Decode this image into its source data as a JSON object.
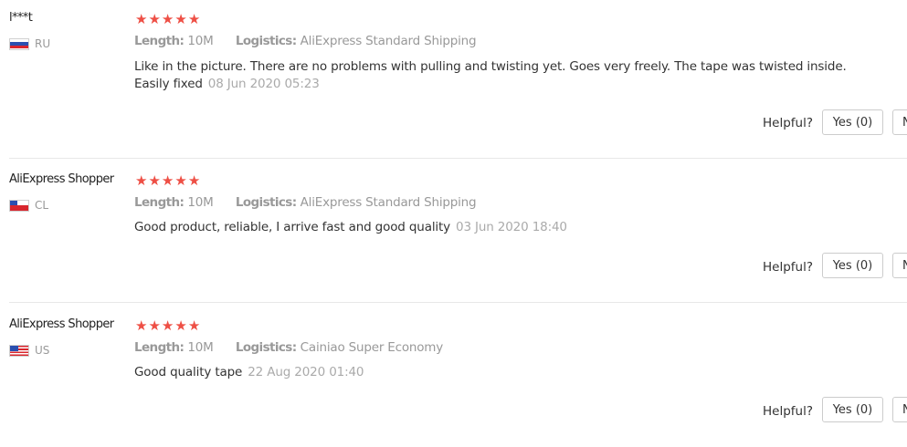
{
  "reviews": [
    {
      "user": "l***t",
      "country_code": "RU",
      "flag": "russia-flag",
      "stars": 5,
      "length_label": "Length:",
      "length_value": "10M",
      "logistics_label": "Logistics:",
      "logistics_value": "AliExpress Standard Shipping",
      "text_line1": "Like in the picture. There are no problems with pulling and twisting yet. Goes very freely. The tape was twisted inside.",
      "text_line2": "Easily fixed",
      "date": "08 Jun 2020 05:23",
      "helpful_label": "Helpful?",
      "yes_label": "Yes (0)",
      "no_label": "N"
    },
    {
      "user": "AliExpress Shopper",
      "country_code": "CL",
      "flag": "chile-flag",
      "stars": 5,
      "length_label": "Length:",
      "length_value": "10M",
      "logistics_label": "Logistics:",
      "logistics_value": "AliExpress Standard Shipping",
      "text_line1": "Good product, reliable, I arrive fast and good quality",
      "text_line2": "",
      "date": "03 Jun 2020 18:40",
      "helpful_label": "Helpful?",
      "yes_label": "Yes (0)",
      "no_label": "N"
    },
    {
      "user": "AliExpress Shopper",
      "country_code": "US",
      "flag": "usa-flag",
      "stars": 5,
      "length_label": "Length:",
      "length_value": "10M",
      "logistics_label": "Logistics:",
      "logistics_value": "Cainiao Super Economy",
      "text_line1": "Good quality tape",
      "text_line2": "",
      "date": "22 Aug 2020 01:40",
      "helpful_label": "Helpful?",
      "yes_label": "Yes (0)",
      "no_label": "N"
    }
  ],
  "colors": {
    "star": "#ee4f45",
    "muted": "#999999",
    "text": "#333333"
  }
}
